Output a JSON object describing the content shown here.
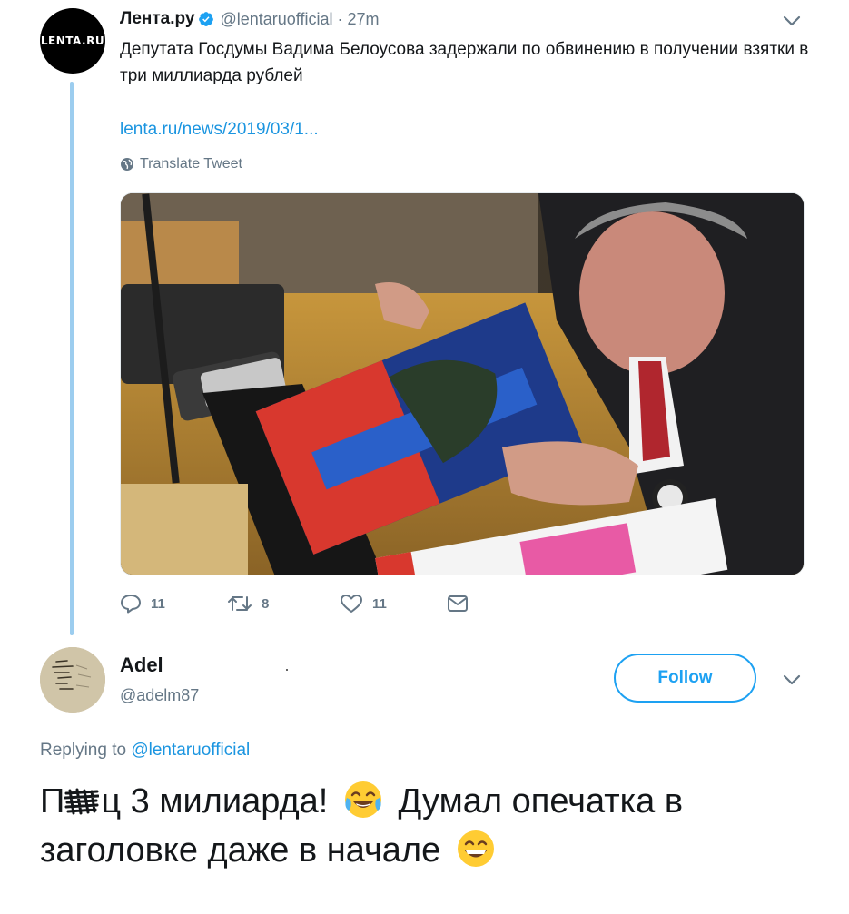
{
  "tweet": {
    "author_name": "Лента.ру",
    "author_handle": "@lentaruofficial",
    "separator": "·",
    "time": "27m",
    "avatar_text": "LENTA.RU",
    "text": "Депутата Госдумы Вадима Белоусова задержали по обвинению в получении взятки в три миллиарда рублей",
    "link": "lenta.ru/news/2019/03/1...",
    "translate_label": "Translate Tweet",
    "media_icon": "photo",
    "counts": {
      "replies": "11",
      "retweets": "8",
      "likes": "11"
    }
  },
  "reply": {
    "author_name": "Adel",
    "author_handle": "@adelm87",
    "follow_label": "Follow",
    "replying_prefix": "Replying to",
    "replying_mention": "@lentaruofficial",
    "text_part1": "ц 3 милиарда!",
    "text_part2": "Думал опечатка в заголовке даже в начале",
    "text_first_letter": "П",
    "emoji1": "face-with-tears-of-joy",
    "emoji2": "grinning-face-with-smiling-eyes"
  },
  "colors": {
    "accent": "#1da1f2",
    "link": "#1b95e0",
    "muted": "#657786",
    "thread_line": "#9ccdef"
  }
}
